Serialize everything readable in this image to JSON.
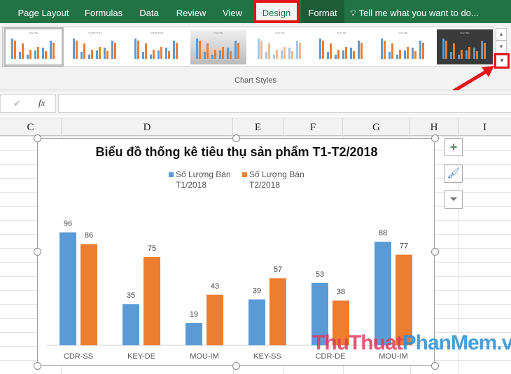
{
  "ribbon": {
    "tabs": [
      "Page Layout",
      "Formulas",
      "Data",
      "Review",
      "View",
      "Design",
      "Format"
    ],
    "active_tab": "Design",
    "tell_me": "Tell me what you want to do...",
    "group_label": "Chart Styles",
    "thumb_title_samples": [
      "Chart Title",
      "CHART TITLE",
      "CHART TITLE",
      "Chart Title",
      "Chart Title",
      "Chart Title",
      "Chart Title",
      "Chart Title"
    ]
  },
  "formula_bar": {
    "check": "✔",
    "fx": "fx",
    "value": ""
  },
  "columns": [
    "C",
    "D",
    "E",
    "F",
    "G",
    "H",
    "I"
  ],
  "colors": {
    "blue": "#5b9bd5",
    "orange": "#ed7d31",
    "excel_green": "#217346",
    "highlight": "#e5141b"
  },
  "chart_data": {
    "type": "bar",
    "title": "Biểu đồ thống kê tiêu thụ sản phẩm T1-T2/2018",
    "categories": [
      "CDR-SS",
      "KEY-DE",
      "MOU-IM",
      "KEY-SS",
      "CDR-DE",
      "MOU-IM"
    ],
    "series": [
      {
        "name": "Số Lượng Bán T1/2018",
        "line1": "Số Lượng Bán",
        "line2": "T1/2018",
        "values": [
          96,
          35,
          19,
          39,
          53,
          88
        ]
      },
      {
        "name": "Số Lượng Bán T2/2018",
        "line1": "Số Lượng Bán",
        "line2": "T2/2018",
        "values": [
          86,
          75,
          43,
          57,
          38,
          77
        ]
      }
    ],
    "legend": "top",
    "data_labels": true,
    "grid": false
  },
  "side_buttons": [
    "chart-elements",
    "chart-styles",
    "chart-filters"
  ],
  "watermark": {
    "part1": "ThuThuat",
    "part2": "PhanMem",
    "part3": ".vn"
  }
}
